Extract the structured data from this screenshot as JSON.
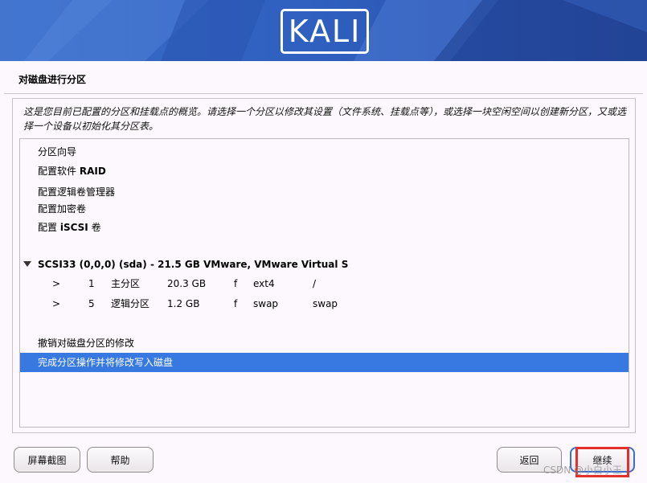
{
  "banner": {
    "logo_text": "KALI"
  },
  "page": {
    "title": "对磁盘进行分区",
    "description": "这是您目前已配置的分区和挂载点的概览。请选择一个分区以修改其设置（文件系统、挂载点等），或选择一块空闲空间以创建新分区，又或选择一个设备以初始化其分区表。"
  },
  "menu": {
    "guided": "分区向导",
    "raid_prefix": "配置软件",
    "raid_bold": "RAID",
    "lvm": "配置逻辑卷管理器",
    "encrypted": "配置加密卷",
    "iscsi_prefix": "配置",
    "iscsi_bold": "iSCSI",
    "iscsi_suffix": "卷"
  },
  "device": {
    "label": "SCSI33 (0,0,0) (sda) - 21.5 GB VMware, VMware Virtual S",
    "partitions": [
      {
        "marker": ">",
        "number": "1",
        "type": "主分区",
        "size": "20.3 GB",
        "flag": "f",
        "fs": "ext4",
        "mount": "/"
      },
      {
        "marker": ">",
        "number": "5",
        "type": "逻辑分区",
        "size": "1.2 GB",
        "flag": "f",
        "fs": "swap",
        "mount": "swap"
      }
    ]
  },
  "actions": {
    "undo": "撤销对磁盘分区的修改",
    "finish": "完成分区操作并将修改写入磁盘"
  },
  "buttons": {
    "screenshot": "屏幕截图",
    "help": "帮助",
    "back": "返回",
    "continue": "继续"
  },
  "watermark": "CSDN @小白小王"
}
